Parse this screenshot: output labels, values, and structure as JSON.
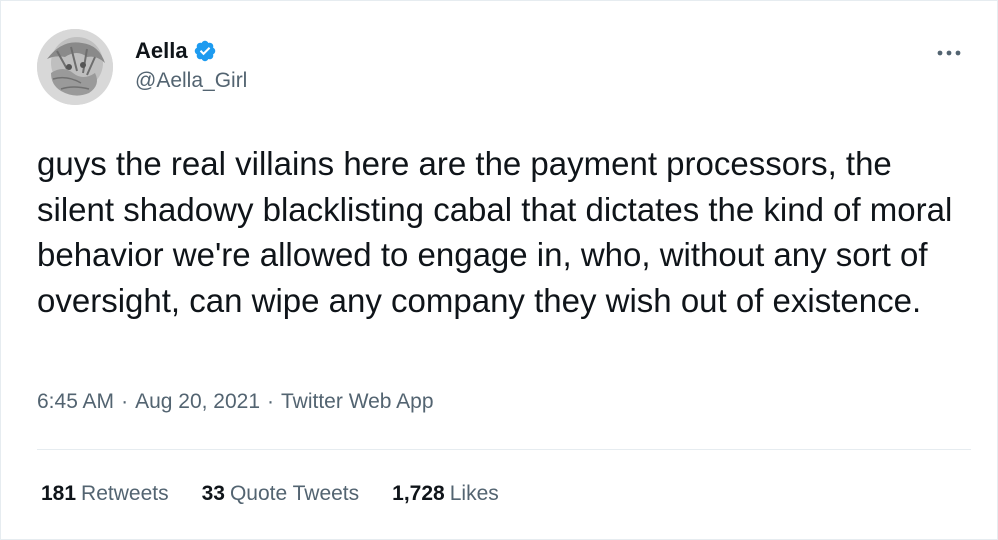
{
  "author": {
    "display_name": "Aella",
    "handle": "@Aella_Girl",
    "verified": true
  },
  "tweet": {
    "text": "guys the real villains here are the payment processors, the silent shadowy blacklisting cabal that dictates the kind of moral behavior we're allowed to engage in, who, without any sort of oversight, can wipe any company they wish out of existence."
  },
  "meta": {
    "time": "6:45 AM",
    "separator": "·",
    "date": "Aug 20, 2021",
    "source": "Twitter Web App"
  },
  "stats": {
    "retweets": {
      "count": "181",
      "label": "Retweets"
    },
    "quote_tweets": {
      "count": "33",
      "label": "Quote Tweets"
    },
    "likes": {
      "count": "1,728",
      "label": "Likes"
    }
  },
  "icons": {
    "verified": "verified-badge-icon",
    "more": "more-options-icon"
  },
  "colors": {
    "text": "#0f1419",
    "secondary": "#536471",
    "verified": "#1d9bf0",
    "border": "#e6ecf0"
  }
}
